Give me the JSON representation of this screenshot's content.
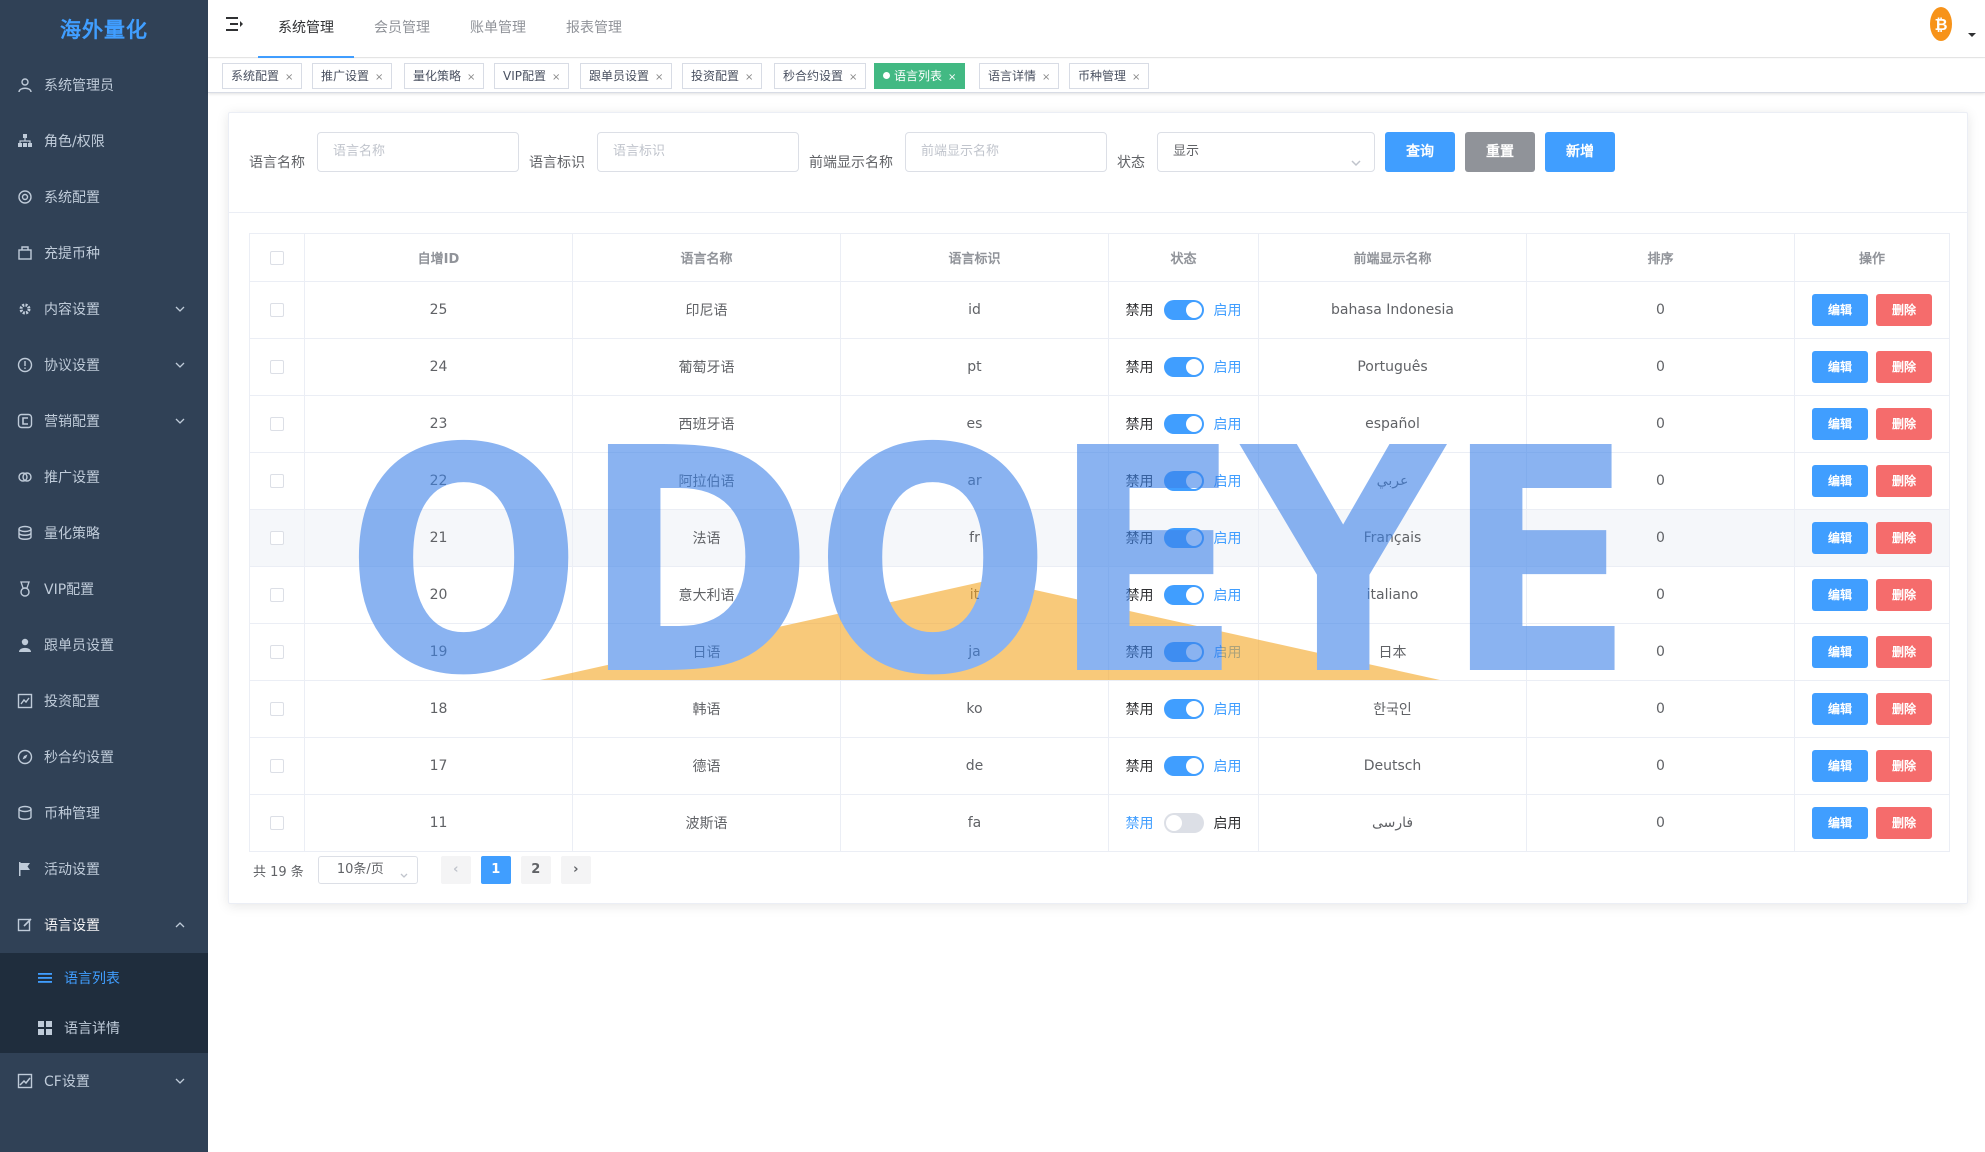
{
  "sidebar": {
    "logo": "海外量化",
    "items": [
      {
        "label": "系统管理员"
      },
      {
        "label": "角色/权限"
      },
      {
        "label": "系统配置"
      },
      {
        "label": "充提币种"
      },
      {
        "label": "内容设置"
      },
      {
        "label": "协议设置"
      },
      {
        "label": "营销配置"
      },
      {
        "label": "推广设置"
      },
      {
        "label": "量化策略"
      },
      {
        "label": "VIP配置"
      },
      {
        "label": "跟单员设置"
      },
      {
        "label": "投资配置"
      },
      {
        "label": "秒合约设置"
      },
      {
        "label": "币种管理"
      },
      {
        "label": "活动设置"
      },
      {
        "label": "语言设置"
      }
    ],
    "submenu": [
      {
        "label": "语言列表"
      },
      {
        "label": "语言详情"
      }
    ],
    "last_item": {
      "label": "CF设置"
    }
  },
  "navbar": {
    "tabs": [
      "系统管理",
      "会员管理",
      "账单管理",
      "报表管理"
    ]
  },
  "tags": [
    {
      "label": "系统配置"
    },
    {
      "label": "推广设置"
    },
    {
      "label": "量化策略"
    },
    {
      "label": "VIP配置"
    },
    {
      "label": "跟单员设置"
    },
    {
      "label": "投资配置"
    },
    {
      "label": "秒合约设置"
    },
    {
      "label": "语言列表"
    },
    {
      "label": "语言详情"
    },
    {
      "label": "币种管理"
    }
  ],
  "tag_close": "×",
  "filters": {
    "name_label": "语言名称",
    "name_placeholder": "语言名称",
    "code_label": "语言标识",
    "code_placeholder": "语言标识",
    "display_label": "前端显示名称",
    "display_placeholder": "前端显示名称",
    "status_label": "状态",
    "status_value": "显示",
    "query_button": "查询",
    "reset_button": "重置",
    "add_button": "新增"
  },
  "table": {
    "headers": [
      "自增ID",
      "语言名称",
      "语言标识",
      "状态",
      "前端显示名称",
      "排序",
      "操作"
    ],
    "switch_off_label": "禁用",
    "switch_on_label": "启用",
    "edit_label": "编辑",
    "delete_label": "删除",
    "rows": [
      {
        "id": "25",
        "name": "印尼语",
        "code": "id",
        "enabled": true,
        "display": "bahasa Indonesia",
        "sort": "0"
      },
      {
        "id": "24",
        "name": "葡萄牙语",
        "code": "pt",
        "enabled": true,
        "display": "Português",
        "sort": "0"
      },
      {
        "id": "23",
        "name": "西班牙语",
        "code": "es",
        "enabled": true,
        "display": "español",
        "sort": "0"
      },
      {
        "id": "22",
        "name": "阿拉伯语",
        "code": "ar",
        "enabled": true,
        "display": "عربي",
        "sort": "0"
      },
      {
        "id": "21",
        "name": "法语",
        "code": "fr",
        "enabled": true,
        "display": "Français",
        "sort": "0"
      },
      {
        "id": "20",
        "name": "意大利语",
        "code": "it",
        "enabled": true,
        "display": "italiano",
        "sort": "0"
      },
      {
        "id": "19",
        "name": "日语",
        "code": "ja",
        "enabled": true,
        "display": "日本",
        "sort": "0"
      },
      {
        "id": "18",
        "name": "韩语",
        "code": "ko",
        "enabled": true,
        "display": "한국인",
        "sort": "0"
      },
      {
        "id": "17",
        "name": "德语",
        "code": "de",
        "enabled": true,
        "display": "Deutsch",
        "sort": "0"
      },
      {
        "id": "11",
        "name": "波斯语",
        "code": "fa",
        "enabled": false,
        "display": "فارسی",
        "sort": "0"
      }
    ]
  },
  "pagination": {
    "total": "共 19 条",
    "page_size": "10条/页",
    "pages": [
      "1",
      "2"
    ],
    "current": "1",
    "prev": "‹",
    "next": "›"
  },
  "watermark": {
    "text": "ODOEYE"
  },
  "colors": {
    "sidebar_bg": "#304156",
    "primary": "#409EFF",
    "danger": "#F56C6C",
    "tag_active": "#42b983",
    "watermark_blue": "#3d82e8",
    "watermark_orange": "#f5a623",
    "btc_orange": "#f7931a"
  }
}
